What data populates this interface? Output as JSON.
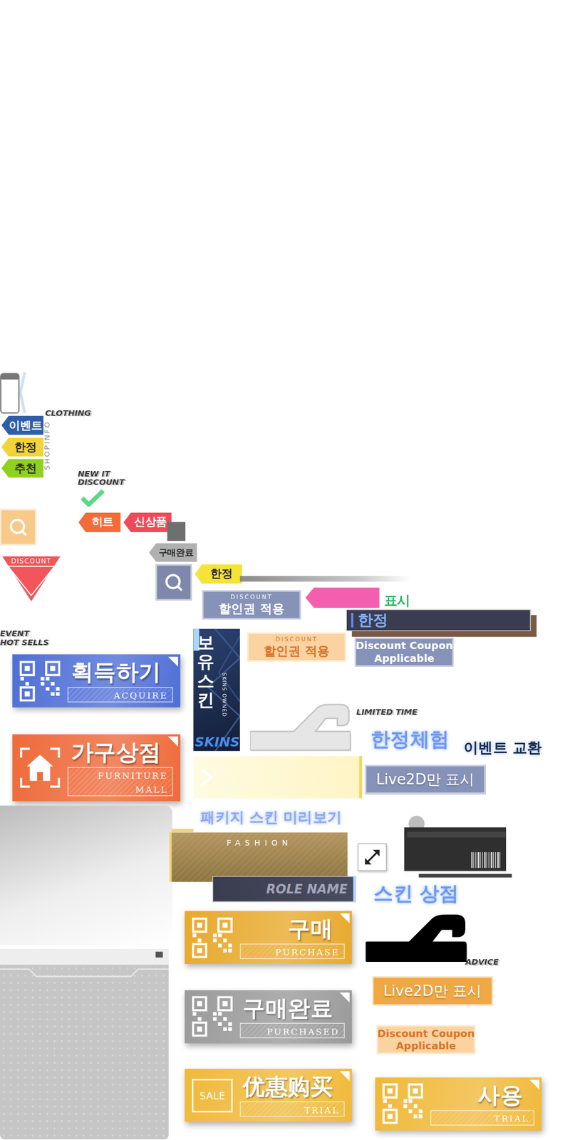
{
  "sprites": [
    {
      "kind": "phone-outline"
    },
    {
      "kind": "vertical-label",
      "text": "SHOPINFO"
    },
    {
      "kind": "italic-label",
      "lines": [
        "CLOTHING"
      ]
    },
    {
      "kind": "arrow-tag",
      "label": "이벤트",
      "color": "#2f5ea8"
    },
    {
      "kind": "arrow-tag",
      "label": "한정",
      "color": "#f2d33a"
    },
    {
      "kind": "arrow-tag",
      "label": "추천",
      "color": "#8ed21e"
    },
    {
      "kind": "italic-label",
      "lines": [
        "NEW IT",
        "DISCOUNT"
      ]
    },
    {
      "kind": "check-icon"
    },
    {
      "kind": "search-tile",
      "color": "#f9c98a"
    },
    {
      "kind": "arrow-tag",
      "label": "히트",
      "color": "#f26b3a"
    },
    {
      "kind": "arrow-tag",
      "label": "신상품",
      "color": "#ee4b5a"
    },
    {
      "kind": "square",
      "color": "#6f6f6f"
    },
    {
      "kind": "arrow-tag",
      "label": "구매완료",
      "color": "#b0b0b0"
    },
    {
      "kind": "discount-triangle",
      "text": "DISCOUNT"
    },
    {
      "kind": "search-tile",
      "color": "#7e88ab"
    },
    {
      "kind": "arrow-tag",
      "label": "한정",
      "color": "#f5e33a"
    },
    {
      "kind": "line"
    },
    {
      "kind": "coupon-box",
      "caption": "DISCOUNT",
      "label": "할인권 적용",
      "color": "#8792b8"
    },
    {
      "kind": "pink-tag",
      "label": "표시",
      "color": "#f35fae"
    },
    {
      "kind": "dark-bar",
      "label": "한정"
    },
    {
      "kind": "italic-label",
      "lines": [
        "EVENT",
        "HOT SELLS"
      ]
    },
    {
      "kind": "skins-card",
      "label": "보유 스킨",
      "sub": "SKINS OWNED",
      "footer": "SKINS"
    },
    {
      "kind": "coupon-box",
      "caption": "DISCOUNT",
      "label": "할인권 적용",
      "color": "#fbd3a0"
    },
    {
      "kind": "coupon-text",
      "lines": [
        "Discount Coupon",
        "Applicable"
      ],
      "color": "#8792b8"
    },
    {
      "kind": "qr-button",
      "label": "획득하기",
      "sub": "ACQUIRE",
      "color": "#4f6fd6"
    },
    {
      "kind": "hook",
      "color": "#e6e6e6"
    },
    {
      "kind": "italic-label",
      "lines": [
        "LIMITED TIME"
      ]
    },
    {
      "kind": "glow-text",
      "text": "한정체험",
      "color": "#6f98f0"
    },
    {
      "kind": "glow-text",
      "text": "이벤트 교환",
      "color": "#1e2b44"
    },
    {
      "kind": "house-button",
      "label": "가구상점",
      "sub": "FURNITURE MALL",
      "color": "#ee6a3a"
    },
    {
      "kind": "pale-bar"
    },
    {
      "kind": "label-box",
      "label": "Live2D만 표시",
      "color": "#8792b8"
    },
    {
      "kind": "gradient-panel"
    },
    {
      "kind": "glow-text",
      "text": "패키지 스킨 미리보기",
      "color": "#8ea7ec"
    },
    {
      "kind": "id-card"
    },
    {
      "kind": "fashion-panel",
      "label": "FASHION"
    },
    {
      "kind": "expand-icon"
    },
    {
      "kind": "role-bar",
      "label": "ROLE NAME"
    },
    {
      "kind": "glow-text",
      "text": "스킨 상점",
      "color": "#6f98f0"
    },
    {
      "kind": "qr-button",
      "label": "구매",
      "sub": "PURCHASE",
      "color": "#e8a92c"
    },
    {
      "kind": "hook",
      "color": "#000000"
    },
    {
      "kind": "italic-label",
      "lines": [
        "ADVICE"
      ]
    },
    {
      "kind": "grid-panel"
    },
    {
      "kind": "label-box",
      "label": "Live2D만 표시",
      "color": "#efa843"
    },
    {
      "kind": "qr-button",
      "label": "구매완료",
      "sub": "PURCHASED",
      "color": "#9a9a9a"
    },
    {
      "kind": "coupon-text",
      "lines": [
        "Discount Coupon",
        "Applicable"
      ],
      "color": "#fbd3a0"
    },
    {
      "kind": "sale-button",
      "badge": "SALE",
      "label": "优惠购买",
      "sub": "TRIAL",
      "color": "#f0b93a"
    },
    {
      "kind": "qr-button",
      "label": "사용",
      "sub": "TRIAL",
      "color": "#f0b93a"
    }
  ]
}
